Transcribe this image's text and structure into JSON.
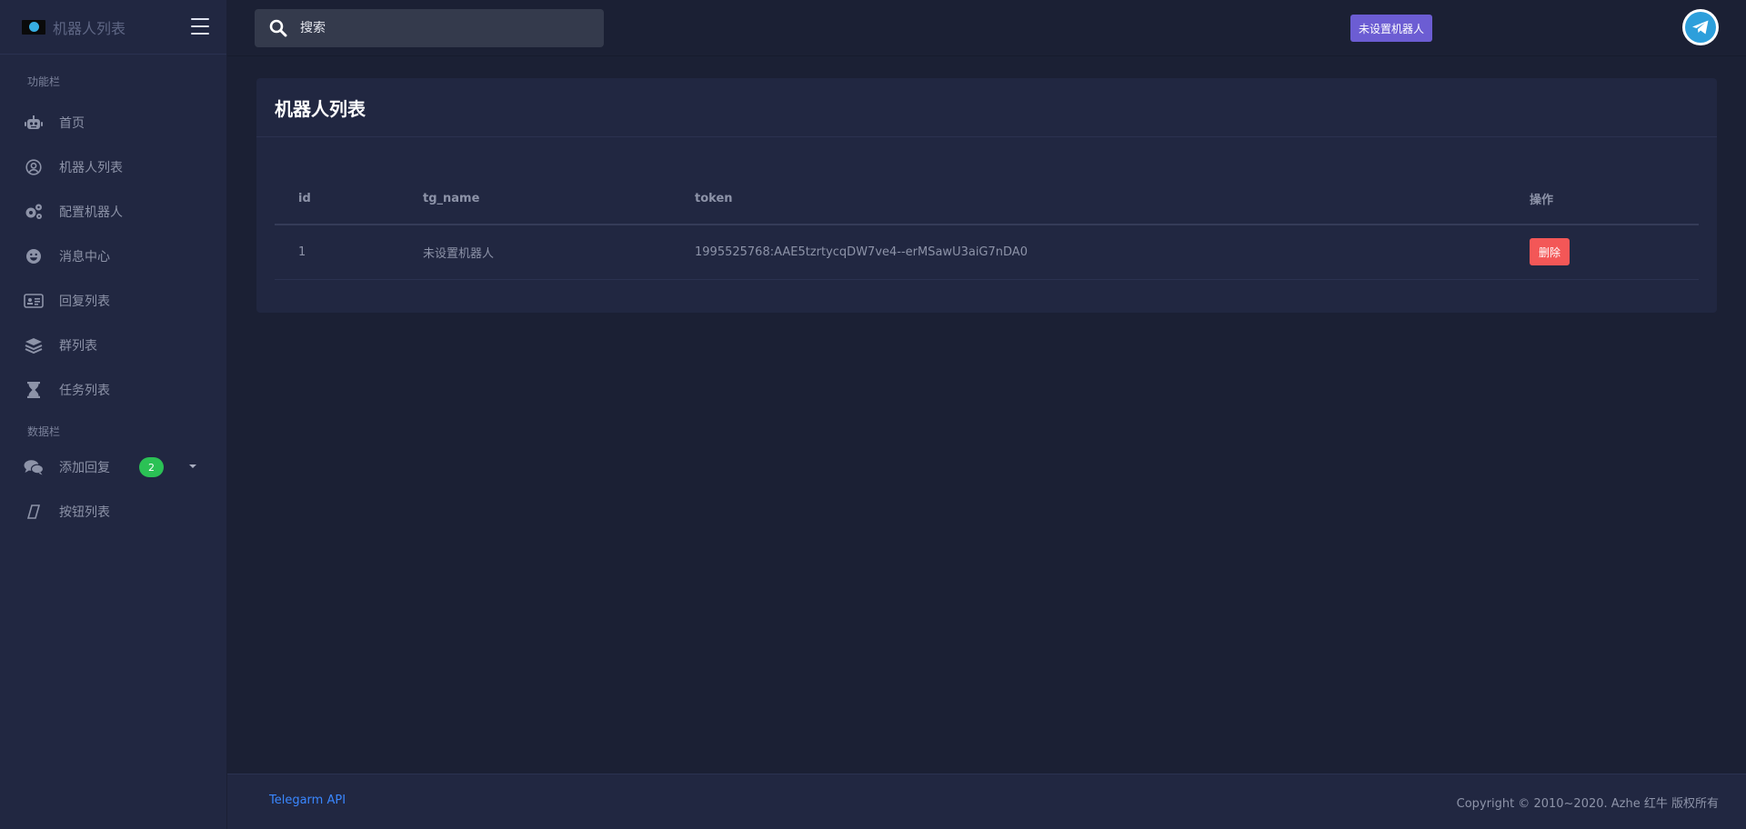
{
  "brand": {
    "title": "机器人列表"
  },
  "sidebar": {
    "section_features": "功能栏",
    "section_data": "数据栏",
    "items": [
      {
        "label": "首页",
        "icon": "robot-icon"
      },
      {
        "label": "机器人列表",
        "icon": "user-circle-icon"
      },
      {
        "label": "配置机器人",
        "icon": "gears-icon"
      },
      {
        "label": "消息中心",
        "icon": "smile-icon"
      },
      {
        "label": "回复列表",
        "icon": "id-card-icon"
      },
      {
        "label": "群列表",
        "icon": "layers-icon"
      },
      {
        "label": "任务列表",
        "icon": "hourglass-icon"
      }
    ],
    "data_items": [
      {
        "label": "添加回复",
        "icon": "comments-icon",
        "badge": "2"
      },
      {
        "label": "按钮列表",
        "icon": "parallelogram-icon"
      }
    ]
  },
  "header": {
    "search_placeholder": "搜索",
    "bot_badge": "未设置机器人"
  },
  "card": {
    "title": "机器人列表",
    "columns": [
      "id",
      "tg_name",
      "token",
      "操作"
    ],
    "rows": [
      {
        "id": "1",
        "tg_name": "未设置机器人",
        "token": "1995525768:AAE5tzrtycqDW7ve4--erMSawU3aiG7nDA0",
        "action": "删除"
      }
    ]
  },
  "footer": {
    "link": "Telegarm API",
    "copyright": "Copyright © 2010~2020. Azhe 红牛 版权所有"
  },
  "colors": {
    "accent": "#6c5dd3",
    "danger": "#f35757",
    "success": "#2bc155",
    "link": "#3a87ff"
  }
}
